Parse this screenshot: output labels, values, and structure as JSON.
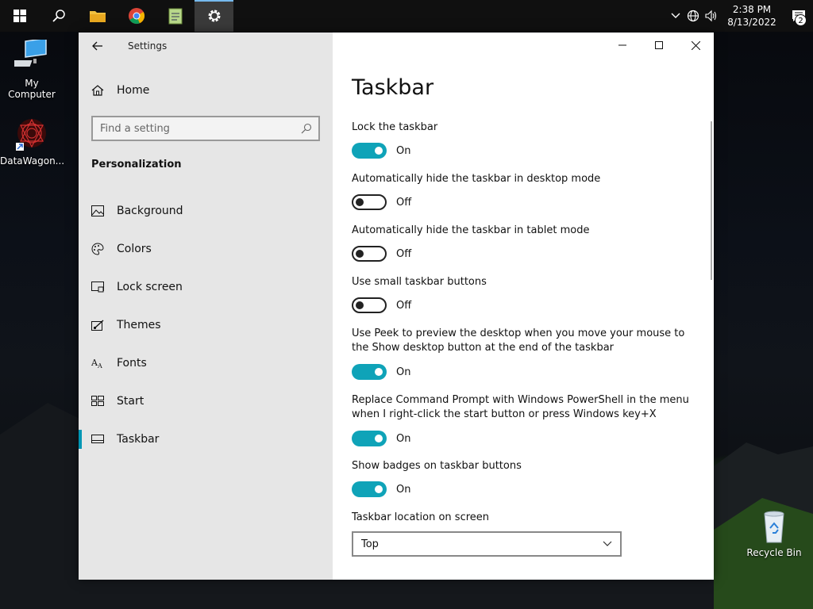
{
  "taskbar": {
    "clock_time": "2:38 PM",
    "clock_date": "8/13/2022",
    "notification_count": "2"
  },
  "desktop": {
    "icons": [
      {
        "label": "My Computer"
      },
      {
        "label": "DataWagon..."
      },
      {
        "label": "Recycle Bin"
      }
    ]
  },
  "window": {
    "app_title": "Settings",
    "sidebar": {
      "home_label": "Home",
      "search_placeholder": "Find a setting",
      "section_title": "Personalization",
      "items": [
        {
          "label": "Background",
          "icon": "picture-icon"
        },
        {
          "label": "Colors",
          "icon": "palette-icon"
        },
        {
          "label": "Lock screen",
          "icon": "lock-screen-icon"
        },
        {
          "label": "Themes",
          "icon": "brush-icon"
        },
        {
          "label": "Fonts",
          "icon": "font-icon"
        },
        {
          "label": "Start",
          "icon": "start-grid-icon"
        },
        {
          "label": "Taskbar",
          "icon": "taskbar-icon",
          "selected": true
        }
      ]
    },
    "main": {
      "page_title": "Taskbar",
      "settings": [
        {
          "label": "Lock the taskbar",
          "state": "On"
        },
        {
          "label": "Automatically hide the taskbar in desktop mode",
          "state": "Off"
        },
        {
          "label": "Automatically hide the taskbar in tablet mode",
          "state": "Off"
        },
        {
          "label": "Use small taskbar buttons",
          "state": "Off"
        },
        {
          "label": "Use Peek to preview the desktop when you move your mouse to the Show desktop button at the end of the taskbar",
          "state": "On"
        },
        {
          "label": "Replace Command Prompt with Windows PowerShell in the menu when I right-click the start button or press Windows key+X",
          "state": "On"
        },
        {
          "label": "Show badges on taskbar buttons",
          "state": "On"
        }
      ],
      "location_label": "Taskbar location on screen",
      "location_value": "Top"
    }
  },
  "colors": {
    "accent": "#0fa3b8",
    "sidebar_bg": "#e6e6e6",
    "taskbar_bg": "#101010"
  }
}
